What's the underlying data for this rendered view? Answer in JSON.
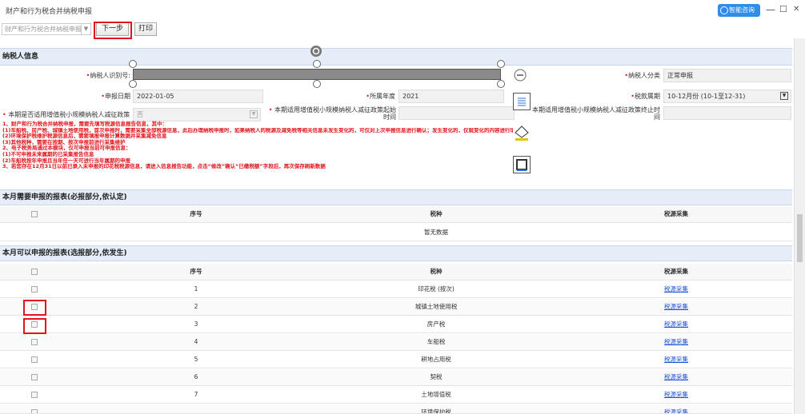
{
  "window": {
    "title": "财产和行为税合并纳税申报",
    "smart_consult": "智能咨询",
    "minimize": "—",
    "restore": "☐",
    "close": "✕"
  },
  "toolbar": {
    "select_value": "财产和行为税合并纳税申报",
    "next_label": "下一步",
    "print_label": "打印"
  },
  "taxpayer": {
    "section_title": "纳税人信息",
    "id_label": "纳税人识别号:",
    "category_label": "纳税人分类",
    "category_value": "正常申报",
    "declare_date_label": "申报日期",
    "declare_date_value": "2022-01-05",
    "year_label": "所属年度",
    "year_value": "2021",
    "period_label": "税款属期",
    "period_value": "10-12月份 (10-1至12-31)",
    "small_scale_label": "本期是否适用增值税小规模纳税人减征政策",
    "small_scale_value": "否",
    "start_label": "本期适用增值税小规模纳税人减征政策起始时间",
    "end_label": "本期适用增值税小规模纳税人减征政策终止时间"
  },
  "notice": [
    "1、财产和行为税合并纳税申报，需要先填写税源信息报告信息，其中：",
    "(1)车船税、房产税、城镇土地使用税，首次申报时，需要采集全部税源信息，此后办理纳税申报时，如果纳税人的税源及减免税等相关信息未发生变化的，可仅对上次申报信息进行确认；发生变化的，仅就变化的内容进行填写",
    "(2)环境保护税维护税源信息后，需要填报申报计算数据并采集减免信息",
    "(3)其他税种，需要在按期、按次申报前进行采集维护",
    "2、电子税务局通过本模块，仅可申报当前可申报信息：",
    "(1)不可申报未来属期的已采集报告信息",
    "(2)车船税按年申报且当年任一天可进行当年属期的申报",
    "3、若您存在12月31日以前已录入未申报的印花税税源信息，请进入信息报告功能，点击“修改”确认“已缴税额”字段后，再次保存刷新数据"
  ],
  "required_section": {
    "title": "本月需要申报的报表(必报部分,依认定)",
    "headers": {
      "seq": "序号",
      "tax": "税种",
      "collect": "税源采集"
    },
    "empty_text": "暂无数据"
  },
  "optional_section": {
    "title": "本月可以申报的报表(选报部分,依发生)",
    "headers": {
      "seq": "序号",
      "tax": "税种",
      "collect": "税源采集"
    },
    "rows": [
      {
        "seq": "1",
        "tax": "印花税 (按次)",
        "collect": "税源采集"
      },
      {
        "seq": "2",
        "tax": "城镇土地使用税",
        "collect": "税源采集"
      },
      {
        "seq": "3",
        "tax": "房产税",
        "collect": "税源采集"
      },
      {
        "seq": "4",
        "tax": "车船税",
        "collect": "税源采集"
      },
      {
        "seq": "5",
        "tax": "耕地占用税",
        "collect": "税源采集"
      },
      {
        "seq": "6",
        "tax": "契税",
        "collect": "税源采集"
      },
      {
        "seq": "7",
        "tax": "土地增值税",
        "collect": "税源采集"
      },
      {
        "seq": "",
        "tax": "环境保护税",
        "collect": "税源采集"
      }
    ]
  },
  "colors": {
    "highlight": "#e0141c",
    "link": "#1a4fd6",
    "accent": "#2e8de8"
  }
}
